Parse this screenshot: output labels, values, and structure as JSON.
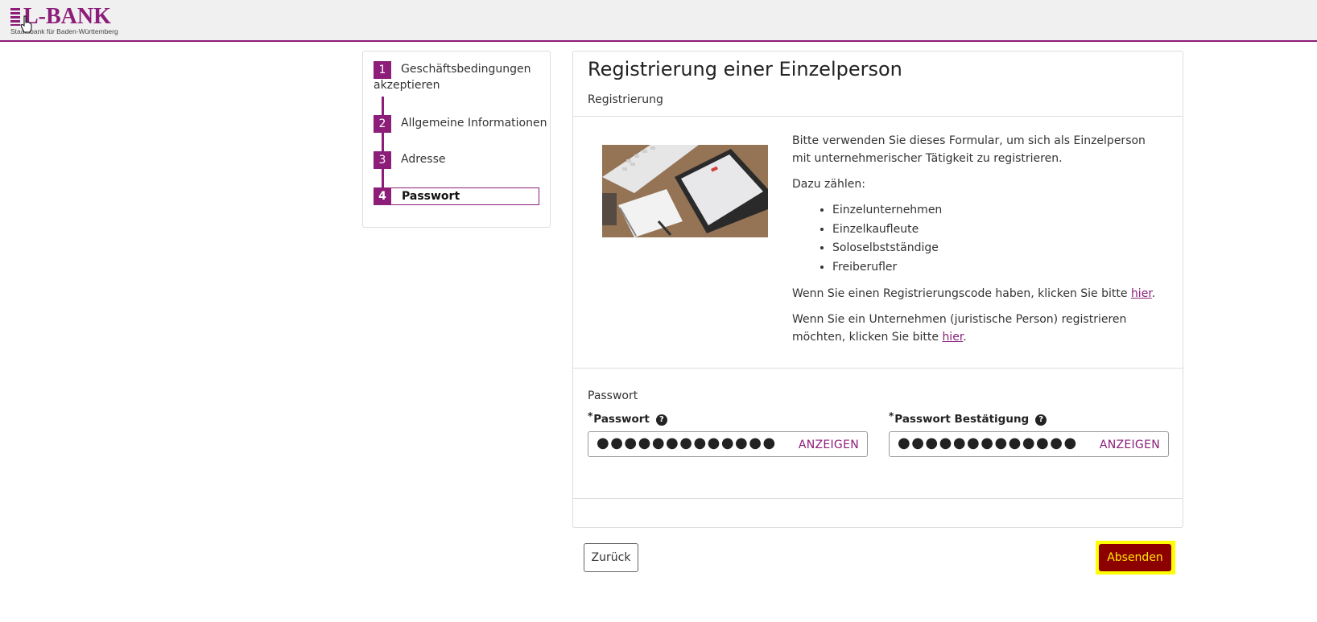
{
  "header": {
    "logo_text": "L-BANK",
    "logo_subtitle": "Staatsbank für Baden-Württemberg",
    "accent_color": "#8c1d79"
  },
  "stepper": {
    "steps": [
      {
        "number": "1",
        "label_line1": "Geschäftsbedingungen",
        "label_line2": "akzeptieren",
        "active": false
      },
      {
        "number": "2",
        "label": "Allgemeine Informationen",
        "active": false
      },
      {
        "number": "3",
        "label": "Adresse",
        "active": false
      },
      {
        "number": "4",
        "label": "Passwort",
        "active": true
      }
    ]
  },
  "main": {
    "title": "Registrierung einer Einzelperson",
    "subtitle": "Registrierung",
    "intro": {
      "paragraph1": "Bitte verwenden Sie dieses Formular, um sich als Einzelperson mit unternehmerischer Tätigkeit zu registrieren.",
      "paragraph2": "Dazu zählen:",
      "list": [
        "Einzelunternehmen",
        "Einzelkaufleute",
        "Soloselbstständige",
        "Freiberufler"
      ],
      "code_text": "Wenn Sie einen Registrierungscode haben, klicken Sie bitte ",
      "code_link": "hier",
      "company_text": "Wenn Sie ein Unternehmen (juristische Person) registrieren möchten, klicken Sie bitte ",
      "company_link": "hier",
      "period": "."
    },
    "password_section": {
      "label": "Passwort",
      "password": {
        "label": "Passwort",
        "required_mark": "*",
        "value_masked": "●●●●●●●●●●●●●",
        "show_label": "ANZEIGEN",
        "help_icon": "question-circle-icon"
      },
      "confirm": {
        "label": "Passwort Bestätigung",
        "required_mark": "*",
        "value_masked": "●●●●●●●●●●●●●",
        "show_label": "ANZEIGEN",
        "help_icon": "question-circle-icon"
      }
    }
  },
  "footer": {
    "back_label": "Zurück",
    "submit_label": "Absenden",
    "submit_bg": "#8c0000",
    "submit_highlight": "#ffff00"
  }
}
